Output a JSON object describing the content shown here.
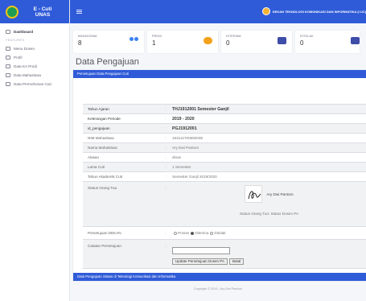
{
  "app": {
    "brand": "E - Cuti\nUNAS"
  },
  "sidebar": {
    "items": [
      {
        "label": "Dashboard"
      },
      {
        "label": "Menu Dosen"
      },
      {
        "label": "Profil"
      },
      {
        "label": "Data KA Prodi"
      },
      {
        "label": "Data Mahasiswa"
      },
      {
        "label": "Data Permohonan Cuti"
      }
    ],
    "section_label": "FEATURES"
  },
  "topbar": {
    "user_name": "DEKAN TEKNOLOGI KOMUNIKASI DAN INFORMATIKA (I UC)"
  },
  "cards": [
    {
      "label": "MAHASISWA",
      "value": "8"
    },
    {
      "label": "PRODI",
      "value": "1"
    },
    {
      "label": "DITERIMA",
      "value": "0"
    },
    {
      "label": "DITOLAK",
      "value": "0"
    }
  ],
  "page": {
    "title": "Data Pengajuan"
  },
  "panel": {
    "header": "Persetujuan Data Pengajuan Cuti",
    "footer": "Data Pengajuan Status di Teknologi Komunikasi dan Informatika"
  },
  "details": {
    "sep": ":",
    "rows": [
      {
        "label": "Tahun Ajaran",
        "value": "THJ1912001 Semester Ganjil"
      },
      {
        "label": "Keterangan Periode",
        "value": "2019 - 2020"
      },
      {
        "label": "id_pengajuan",
        "value": "PGJ1912001"
      },
      {
        "label": "NIM Mahasiswa",
        "value": "163112700650039"
      },
      {
        "label": "Nama Mahasiswa",
        "value": "Ary Dwi Pantoro"
      },
      {
        "label": "Alasan",
        "value": "dinas"
      },
      {
        "label": "Lama Cuti",
        "value": "1 Semester"
      },
      {
        "label": "Tahun Akademik Cuti",
        "value": "Semester Ganjil 2019/2020"
      }
    ],
    "status_ortu": {
      "label": "Status Orang Tua",
      "signer": "Ary Dwi Pantoro",
      "status_text": "Status Orang Tua: Status Dosen PA"
    },
    "persetujuan": {
      "label": "Persetujuan DEKAN",
      "options": [
        "Proses",
        "Diterima",
        "Ditolak"
      ],
      "selected": "Diterima"
    },
    "catatan": {
      "label": "Catatan Persetujuan",
      "value": "",
      "update_label": "Update Persetujuan Dosen PA",
      "cancel_label": "Batal"
    }
  },
  "footer": {
    "text": "Copyright © 2019 - Ary Dwi Pantoro"
  }
}
